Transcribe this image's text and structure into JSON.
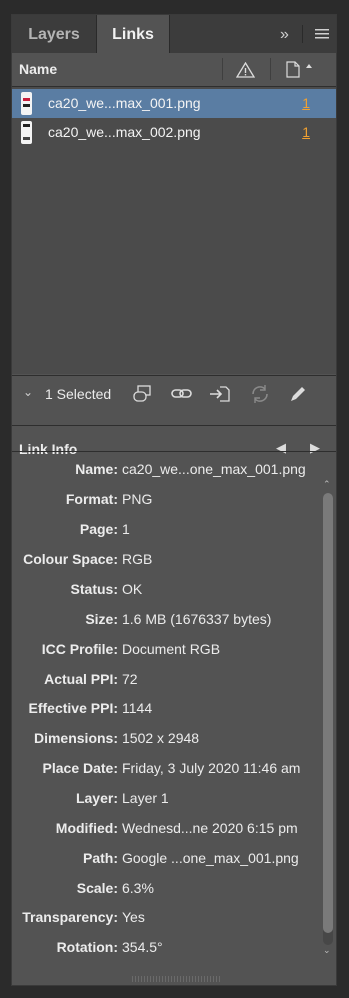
{
  "tabs": [
    {
      "label": "Layers"
    },
    {
      "label": "Links"
    }
  ],
  "header_icons": {
    "overflow": "chevron-double-right-icon",
    "menu": "hamburger-menu-icon"
  },
  "columns": {
    "name": "Name",
    "status_icon": "warning-icon",
    "page_icon": "page-icon"
  },
  "links": [
    {
      "name": "ca20_we...max_001.png",
      "page": "1",
      "selected": true
    },
    {
      "name": "ca20_we...max_002.png",
      "page": "1",
      "selected": false
    }
  ],
  "selection": {
    "count_label": "1 Selected"
  },
  "toolbar_icons": [
    "relink-from-cc-icon",
    "relink-icon",
    "go-to-link-icon",
    "update-link-icon",
    "edit-original-icon"
  ],
  "link_info": {
    "title": "Link Info",
    "rows": [
      {
        "label": "Name:",
        "value": "ca20_we...one_max_001.png"
      },
      {
        "label": "Format:",
        "value": "PNG"
      },
      {
        "label": "Page:",
        "value": "1"
      },
      {
        "label": "Colour Space:",
        "value": "RGB"
      },
      {
        "label": "Status:",
        "value": "OK"
      },
      {
        "label": "Size:",
        "value": "1.6 MB (1676337 bytes)"
      },
      {
        "label": "ICC Profile:",
        "value": "Document RGB"
      },
      {
        "label": "Actual PPI:",
        "value": "72"
      },
      {
        "label": "Effective PPI:",
        "value": "1144"
      },
      {
        "label": "Dimensions:",
        "value": "1502 x 2948"
      },
      {
        "label": "Place Date:",
        "value": "Friday, 3 July 2020 11:46 am"
      },
      {
        "label": "Layer:",
        "value": "Layer 1"
      },
      {
        "label": "Modified:",
        "value": "Wednesd...ne 2020 6:15 pm"
      },
      {
        "label": "Path:",
        "value": "Google ...one_max_001.png"
      },
      {
        "label": "Scale:",
        "value": "6.3%"
      },
      {
        "label": "Transparency:",
        "value": "Yes"
      },
      {
        "label": "Rotation:",
        "value": "354.5°"
      }
    ]
  }
}
